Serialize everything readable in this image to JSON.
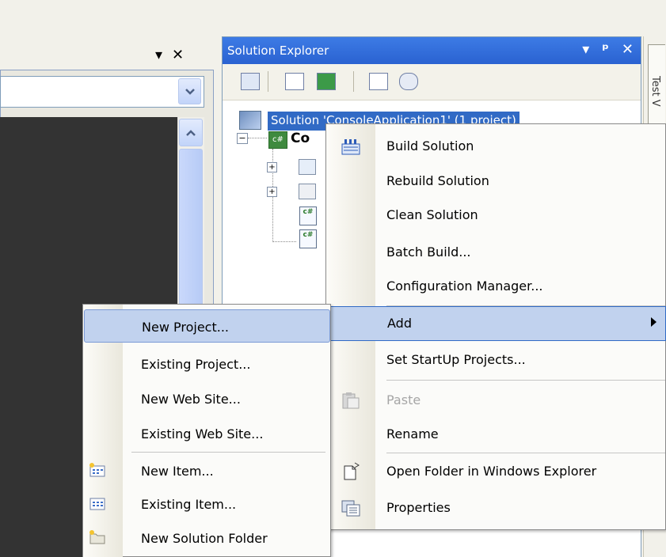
{
  "left_panel": {
    "title_buttons": {
      "dropdown": "▾",
      "close": "✕"
    }
  },
  "solution_explorer": {
    "title": "Solution Explorer",
    "title_buttons": {
      "dropdown": "▾",
      "pin": "ᵖ",
      "close": "✕"
    },
    "tree": {
      "solution_label": "Solution 'ConsoleApplication1' (1 project)",
      "project_label_partial": "Co",
      "cs_badge": "c#"
    }
  },
  "right_strip": {
    "tab_label": "Test V"
  },
  "context_menu": {
    "items": [
      {
        "label": "Build Solution",
        "icon": "build-solution-icon"
      },
      {
        "label": "Rebuild Solution"
      },
      {
        "label": "Clean Solution"
      },
      {
        "label": "Batch Build..."
      },
      {
        "label": "Configuration Manager..."
      },
      {
        "label": "Add",
        "highlighted": true,
        "submenu": true
      },
      {
        "label": "Set StartUp Projects..."
      },
      {
        "label": "Paste",
        "disabled": true,
        "icon": "paste-icon"
      },
      {
        "label": "Rename"
      },
      {
        "label": "Open Folder in Windows Explorer",
        "icon": "open-folder-icon"
      },
      {
        "label": "Properties",
        "icon": "properties-icon"
      }
    ]
  },
  "add_submenu": {
    "items": [
      {
        "label": "New Project...",
        "highlighted": true
      },
      {
        "label": "Existing Project..."
      },
      {
        "label": "New Web Site..."
      },
      {
        "label": "Existing Web Site..."
      },
      {
        "label": "New Item...",
        "icon": "new-item-icon"
      },
      {
        "label": "Existing Item...",
        "icon": "existing-item-icon"
      },
      {
        "label": "New Solution Folder",
        "icon": "new-solution-folder-icon"
      }
    ]
  },
  "colors": {
    "titlebar": "#2a62d1",
    "selection": "#316ac5",
    "menu_highlight": "#c1d2ee",
    "editor_bg": "#333333"
  }
}
